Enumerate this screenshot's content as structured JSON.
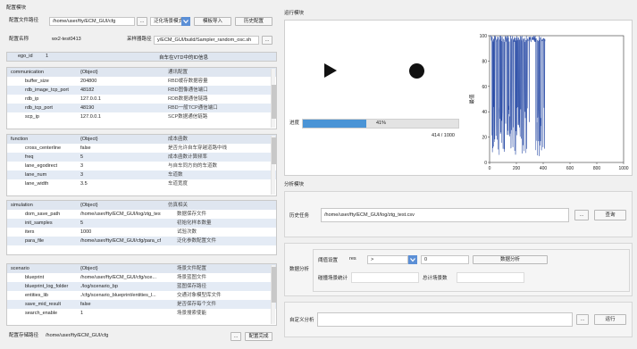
{
  "config": {
    "section_title": "配置模块",
    "file_path_label": "配置文件路径",
    "file_path_value": "/home/user/fty/ECM_GUI/cfg",
    "dots": "...",
    "scene_mode": "泛化场景模式",
    "template_import": "模板导入",
    "history_config": "历史配置",
    "config_name_label": "配置名称",
    "config_name_value": "wx2-test0413",
    "sampler_path_label": "采样器路径",
    "sampler_path_value": "y/ECM_GUI/build/Sampler_random_osc.sh",
    "ego_key": "ego_id",
    "ego_value": "1",
    "ego_desc": "自车在VTD中的ID信息"
  },
  "panels": {
    "communication": {
      "rows": [
        [
          "communication",
          "{Object}",
          "通讯配置"
        ],
        [
          "buffer_size",
          "204800",
          "RBD缓存数据容量"
        ],
        [
          "rdb_image_tcp_port",
          "48182",
          "RBD图像通信端口"
        ],
        [
          "rdb_ip",
          "127.0.0.1",
          "RDB数据通信链路"
        ],
        [
          "rdb_tcp_port",
          "48190",
          "RBD一般TCP通信端口"
        ],
        [
          "scp_ip",
          "127.0.0.1",
          "SCP数据通信链路"
        ]
      ]
    },
    "function": {
      "rows": [
        [
          "function",
          "{Object}",
          "成本函数"
        ],
        [
          "cross_centerline",
          "false",
          "是否允许自车穿越道路中线"
        ],
        [
          "freq",
          "5",
          "成本函数计算频率"
        ],
        [
          "lane_egodirect",
          "3",
          "与自车同方向的车道数"
        ],
        [
          "lane_num",
          "3",
          "车道数"
        ],
        [
          "lane_width",
          "3.5",
          "车道宽度"
        ]
      ]
    },
    "simulation": {
      "rows": [
        [
          "simulation",
          "{Object}",
          "仿真相关"
        ],
        [
          "dom_save_path",
          "/home/user/fty/ECM_GUI/log/ztg_test...",
          "数据保存文件"
        ],
        [
          "init_samples",
          "5",
          "初始化样本数量"
        ],
        [
          "iters",
          "1000",
          "试验次数"
        ],
        [
          "para_file",
          "/home/user/fty/ECM_GUI/cfg/para_cf...",
          "泛化参数配置文件"
        ]
      ]
    },
    "scenario": {
      "rows": [
        [
          "scenario",
          "{Object}",
          "场景文件配置"
        ],
        [
          "blueprint",
          "/home/user/fty/ECM_GUI/cfg/sce...",
          "场景蓝图文件"
        ],
        [
          "blueprint_log_folder",
          "./log/scenario_bp",
          "蓝图保存路径"
        ],
        [
          "entities_lib",
          "./cfg/scenario_blueprint/entities_l...",
          "交通对象模型库文件"
        ],
        [
          "save_mid_result",
          "false",
          "是否保存每个文件"
        ],
        [
          "search_enable",
          "1",
          "场景搜索使能"
        ]
      ]
    }
  },
  "bottom": {
    "save_path_label": "配置存储路径",
    "save_path_value": "/home/user/fty/ECM_GUI/cfg",
    "dots": "...",
    "done": "配置完成"
  },
  "run": {
    "section_title": "运行模块",
    "progress_label": "进度",
    "progress_text": "41%",
    "progress_fraction": 0.41,
    "count_text": "414 / 1000"
  },
  "chart_data": {
    "type": "line",
    "ylabel": "最值",
    "xlim": [
      0,
      1000
    ],
    "ylim": [
      0,
      100
    ],
    "xticks": [
      "0",
      "200",
      "400",
      "600",
      "800",
      "1000"
    ],
    "yticks": [
      "0",
      "20",
      "40",
      "60",
      "80",
      "100"
    ],
    "series_color": "#1a3fa0",
    "note_series": "dense oscillating series for iterations 0-414 (values spanning ~5 to 100)"
  },
  "analysis": {
    "section_title": "分析模块",
    "history_label": "历史任务",
    "history_value": "/home/user/fty/ECM_GUI/log/ztg_test.csv",
    "dots": "...",
    "query": "查询",
    "data_analysis_label": "数据分析",
    "threshold_label": "阈值设置",
    "res_label": "res",
    "operator_value": ">",
    "threshold_value": "0",
    "analyze_button": "数据分析",
    "collision_label": "碰撞场景统计",
    "total_label": "总计场景数",
    "custom_label": "自定义分析",
    "run_button": "运行"
  }
}
